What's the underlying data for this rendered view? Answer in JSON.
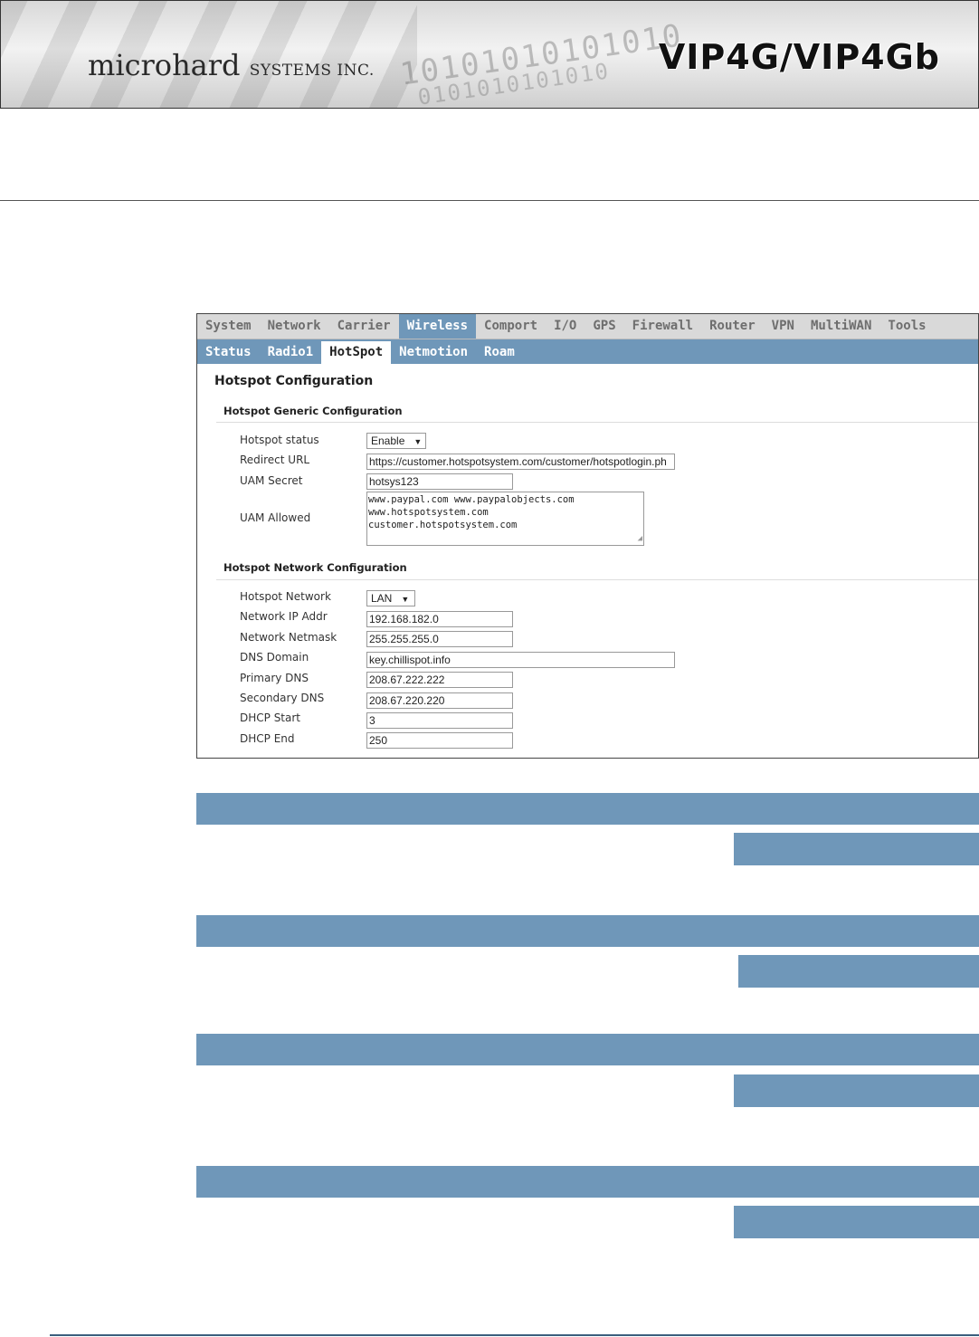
{
  "header": {
    "brand_main": "microhard",
    "brand_sub": "SYSTEMS INC.",
    "model": "VIP4G/VIP4Gb",
    "binary_line1": "10101010101010",
    "binary_line2": "0101010101010"
  },
  "topnav": [
    "System",
    "Network",
    "Carrier",
    "Wireless",
    "Comport",
    "I/O",
    "GPS",
    "Firewall",
    "Router",
    "VPN",
    "MultiWAN",
    "Tools"
  ],
  "topnav_active": "Wireless",
  "subnav": [
    "Status",
    "Radio1",
    "HotSpot",
    "Netmotion",
    "Roam"
  ],
  "subnav_active": "HotSpot",
  "page_title": "Hotspot Configuration",
  "generic": {
    "title": "Hotspot Generic Configuration",
    "status_label": "Hotspot status",
    "status_value": "Enable",
    "redirect_label": "Redirect URL",
    "redirect_value": "https://customer.hotspotsystem.com/customer/hotspotlogin.ph",
    "secret_label": "UAM Secret",
    "secret_value": "hotsys123",
    "allowed_label": "UAM Allowed",
    "allowed_line1": "www.paypal.com www.paypalobjects.com",
    "allowed_line2": "www.hotspotsystem.com",
    "allowed_line3": "customer.hotspotsystem.com"
  },
  "network": {
    "title": "Hotspot Network Configuration",
    "network_label": "Hotspot Network",
    "network_value": "LAN",
    "ip_label": "Network IP Addr",
    "ip_value": "192.168.182.0",
    "netmask_label": "Network Netmask",
    "netmask_value": "255.255.255.0",
    "dns_domain_label": "DNS Domain",
    "dns_domain_value": "key.chillispot.info",
    "primary_dns_label": "Primary DNS",
    "primary_dns_value": "208.67.222.222",
    "secondary_dns_label": "Secondary DNS",
    "secondary_dns_value": "208.67.220.220",
    "dhcp_start_label": "DHCP Start",
    "dhcp_start_value": "3",
    "dhcp_end_label": "DHCP End",
    "dhcp_end_value": "250"
  },
  "colors": {
    "accent": "#6f97b9",
    "nav_bg": "#d9d9d9"
  }
}
